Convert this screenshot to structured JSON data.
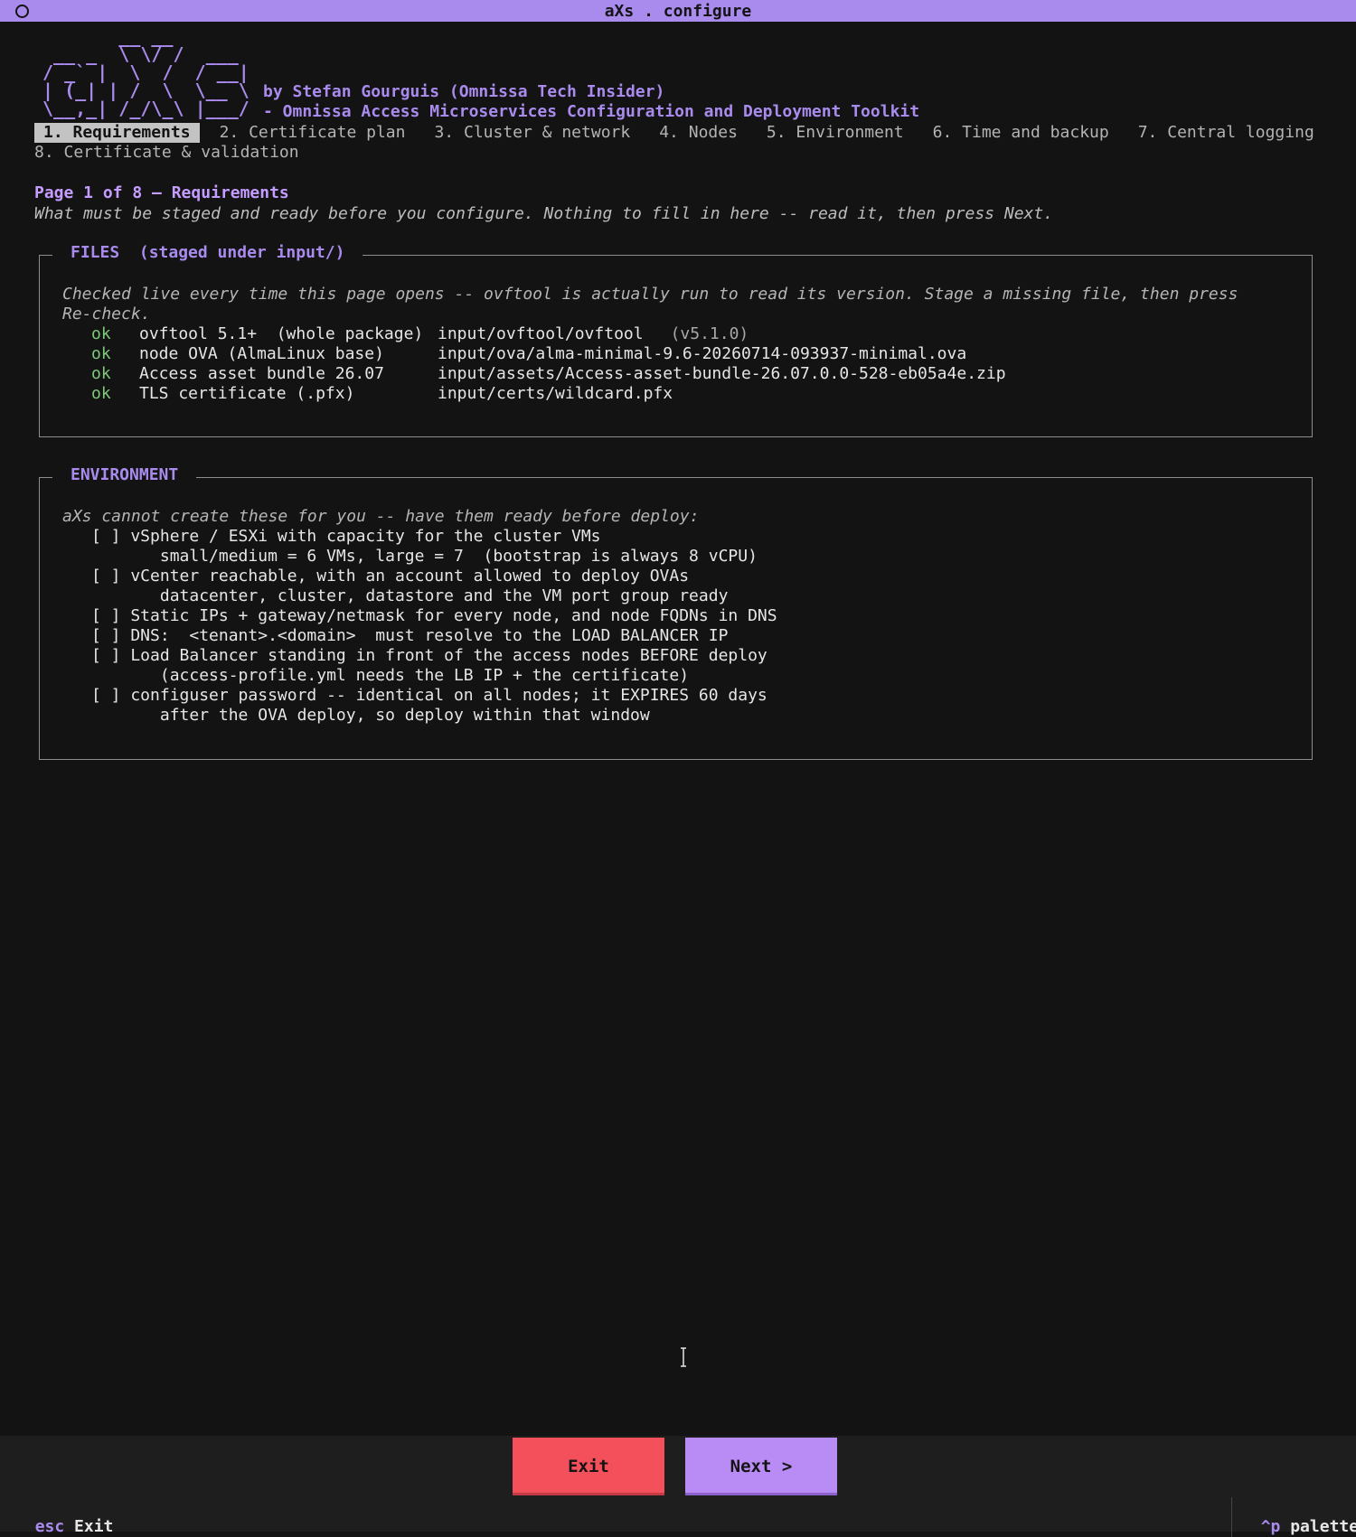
{
  "window": {
    "title": "aXs . configure"
  },
  "logo": {
    "ascii": "       __ __\n __ _  \\ \\/ /  ___\n/ _` |  \\  /  / __|\n| (_| | /  \\  \\__ \\\n\\__,_| /_/\\_\\ |___/"
  },
  "header": {
    "byline": "by Stefan Gourguis (Omnissa Tech Insider)",
    "subtitle": "- Omnissa Access Microservices Configuration and Deployment Toolkit"
  },
  "tabs": [
    {
      "label": "1. Requirements",
      "active": true
    },
    {
      "label": "2. Certificate plan",
      "active": false
    },
    {
      "label": "3. Cluster & network",
      "active": false
    },
    {
      "label": "4. Nodes",
      "active": false
    },
    {
      "label": "5. Environment",
      "active": false
    },
    {
      "label": "6. Time and backup",
      "active": false
    },
    {
      "label": "7. Central logging",
      "active": false
    },
    {
      "label": "8. Certificate & validation",
      "active": false
    }
  ],
  "page": {
    "title": "Page 1 of 8 — Requirements",
    "description": "What must be staged and ready before you configure. Nothing to fill in here -- read it, then press Next."
  },
  "files_panel": {
    "legend": "FILES  (staged under input/)",
    "note_line1": "Checked live every time this page opens -- ovftool is actually run to read its version. Stage a missing file, then press",
    "note_line2": "Re-check.",
    "items": [
      {
        "status": "ok",
        "label": "ovftool 5.1+  (whole package)",
        "path": "input/ovftool/ovftool",
        "version": "(v5.1.0)"
      },
      {
        "status": "ok",
        "label": "node OVA (AlmaLinux base)",
        "path": "input/ova/alma-minimal-9.6-20260714-093937-minimal.ova",
        "version": ""
      },
      {
        "status": "ok",
        "label": "Access asset bundle 26.07",
        "path": "input/assets/Access-asset-bundle-26.07.0.0-528-eb05a4e.zip",
        "version": ""
      },
      {
        "status": "ok",
        "label": "TLS certificate (.pfx)",
        "path": "input/certs/wildcard.pfx",
        "version": ""
      }
    ]
  },
  "environment_panel": {
    "legend": "ENVIRONMENT",
    "note": "aXs cannot create these for you -- have them ready before deploy:",
    "lines": [
      "[ ] vSphere / ESXi with capacity for the cluster VMs",
      "       small/medium = 6 VMs, large = 7  (bootstrap is always 8 vCPU)",
      "[ ] vCenter reachable, with an account allowed to deploy OVAs",
      "       datacenter, cluster, datastore and the VM port group ready",
      "[ ] Static IPs + gateway/netmask for every node, and node FQDNs in DNS",
      "[ ] DNS:  <tenant>.<domain>  must resolve to the LOAD BALANCER IP",
      "[ ] Load Balancer standing in front of the access nodes BEFORE deploy",
      "       (access-profile.yml needs the LB IP + the certificate)",
      "[ ] configuser password -- identical on all nodes; it EXPIRES 60 days",
      "       after the OVA deploy, so deploy within that window"
    ]
  },
  "buttons": {
    "exit": "Exit",
    "next": "Next >"
  },
  "statusbar": {
    "left_key": "esc",
    "left_label": "Exit",
    "right_key": "^p",
    "right_label": "palette"
  },
  "colors": {
    "accent": "#a98bee",
    "ok": "#7ec87a",
    "exit_button": "#f3505b",
    "next_button": "#b98cf5",
    "background": "#131313"
  }
}
